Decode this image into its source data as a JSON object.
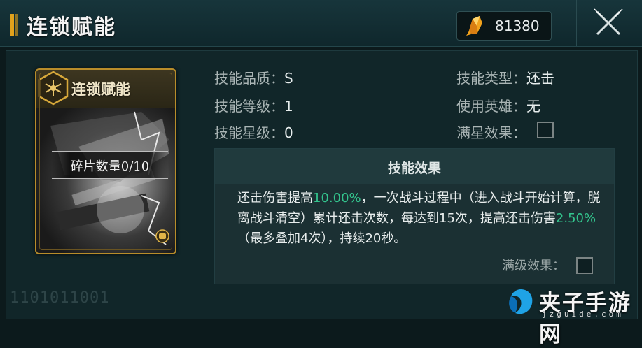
{
  "header": {
    "title": "连锁赋能",
    "currency_value": "81380",
    "icons": {
      "currency": "crystal-icon",
      "close": "close-icon"
    }
  },
  "card": {
    "title": "连锁赋能",
    "fragment_label": "碎片数量0/10",
    "icons": {
      "emblem": "hexagon-emblem-icon",
      "badge": "fist-icon"
    }
  },
  "attributes": {
    "quality_label": "技能品质：",
    "quality_value": "S",
    "level_label": "技能等级：",
    "level_value": "1",
    "star_label": "技能星级：",
    "star_value": "0",
    "type_label": "技能类型：",
    "type_value": "还击",
    "hero_label": "使用英雄：",
    "hero_value": "无",
    "star_effect_label": "满星效果："
  },
  "effect": {
    "title": "技能效果",
    "text_1": "还击伤害提高",
    "value_1": "10.00%",
    "text_2": "，一次战斗过程中（进入战斗开始计算，脱离战斗清空）累计还击次数，每达到15次，提高还击伤害",
    "value_2": "2.50%",
    "text_3": "（最多叠加4次），持续20秒。",
    "max_level_label": "满级效果："
  },
  "colors": {
    "accent": "#e1a21c",
    "highlight": "#33c48d",
    "background": "#0c1a1c"
  },
  "watermark": {
    "code": "1101011001"
  },
  "site_logo": {
    "name": "夹子手游网",
    "url": "jzguide.com"
  }
}
